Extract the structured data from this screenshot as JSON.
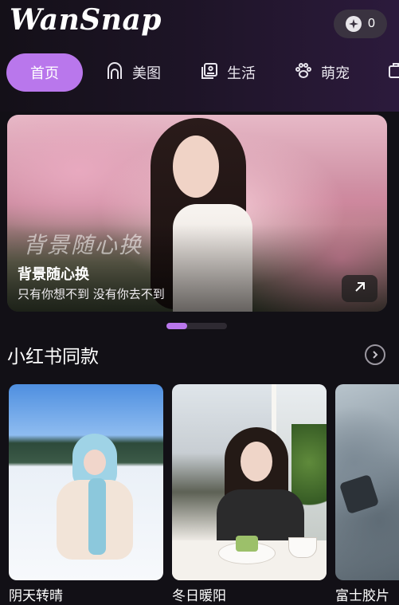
{
  "app": {
    "name": "WanSnap"
  },
  "header": {
    "coin_count": "0",
    "coin_icon": "coin-icon"
  },
  "tabs": [
    {
      "label": "首页",
      "active": true
    },
    {
      "label": "美图",
      "icon": "portrait-icon"
    },
    {
      "label": "生活",
      "icon": "photo-frame-icon"
    },
    {
      "label": "萌宠",
      "icon": "paw-icon"
    }
  ],
  "banner": {
    "script_text": "背景随心换",
    "title": "背景随心换",
    "subtitle": "只有你想不到 没有你去不到",
    "arrow_icon": "arrow-up-right-icon"
  },
  "carousel": {
    "total": 3,
    "active": 1
  },
  "section": {
    "title": "小红书同款",
    "more_icon": "chevron-right-icon"
  },
  "cards": [
    {
      "label": "阴天转晴"
    },
    {
      "label": "冬日暖阳"
    },
    {
      "label": "富士胶片"
    }
  ],
  "colors": {
    "accent": "#b977ec",
    "background": "#121016"
  }
}
